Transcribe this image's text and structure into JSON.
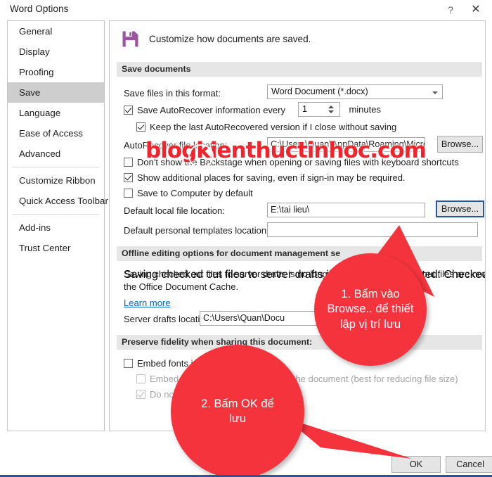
{
  "window": {
    "title": "Word Options",
    "help_icon": "?",
    "close_icon": "✕"
  },
  "sidebar": {
    "items": [
      {
        "label": "General",
        "selected": false
      },
      {
        "label": "Display",
        "selected": false
      },
      {
        "label": "Proofing",
        "selected": false
      },
      {
        "label": "Save",
        "selected": true
      },
      {
        "label": "Language",
        "selected": false
      },
      {
        "label": "Ease of Access",
        "selected": false
      },
      {
        "label": "Advanced",
        "selected": false
      },
      {
        "label": "Customize Ribbon",
        "selected": false
      },
      {
        "label": "Quick Access Toolbar",
        "selected": false
      },
      {
        "label": "Add-ins",
        "selected": false
      },
      {
        "label": "Trust Center",
        "selected": false
      }
    ]
  },
  "content": {
    "header": "Customize how documents are saved.",
    "header_icon": "save-floppy-icon",
    "sections": {
      "save_documents": "Save documents",
      "offline_editing": "Offline editing options for document management se",
      "preserve_fidelity": "Preserve fidelity when sharing this document:"
    },
    "save_format_label": "Save files in this format:",
    "save_format_value": "Word Document (*.docx)",
    "autorecover_label": "Save AutoRecover information every",
    "autorecover_value": "1",
    "autorecover_unit": "minutes",
    "keep_last_label": "Keep the last AutoRecovered version if I close without saving",
    "autorecover_location_label": "AutoRecover file location:",
    "autorecover_location_value": "C:\\Users\\Quan\\AppData\\Roaming\\Microsoft",
    "autorecover_browse": "Browse...",
    "dont_show_backstage": "Don't show the Backstage when opening or saving files with keyboard shortcuts",
    "show_additional_places": "Show additional places for saving, even if sign-in may be required.",
    "save_to_computer": "Save to Computer by default",
    "default_local_label": "Default local file location:",
    "default_local_value": "E:\\tai lieu\\",
    "default_local_browse": "Browse...",
    "default_templates_label": "Default personal templates location:",
    "default_templates_value": "",
    "offline_text_line1": "Saving checked out files to server drafts is no longer supported. Checked out files are now saved to",
    "offline_text_line2": "the Office Document Cache.",
    "learn_more": "Learn more",
    "server_drafts_label": "Server drafts location:",
    "server_drafts_value": "C:\\Users\\Quan\\Docu",
    "embed_fonts": "Embed fonts in the file",
    "embed_only_used": "Embed only the characters used in the document (best for reducing file size)",
    "do_not_embed": "Do not embed common system fonts"
  },
  "footer": {
    "ok": "OK",
    "cancel": "Cancel"
  },
  "annotations": {
    "watermark": "blogkienthuctinhoc.com",
    "callout_1": "1. Bấm vào Browse.. để thiết lập vị trí lưu",
    "callout_2": "2. Bấm OK để lưu"
  },
  "colors": {
    "accent": "#2a5699",
    "callout": "#f4333d",
    "watermark": "#f1232c",
    "selected_nav": "#cecece",
    "section_bar": "#e6e6e6",
    "floppy": "#9a54a0"
  }
}
